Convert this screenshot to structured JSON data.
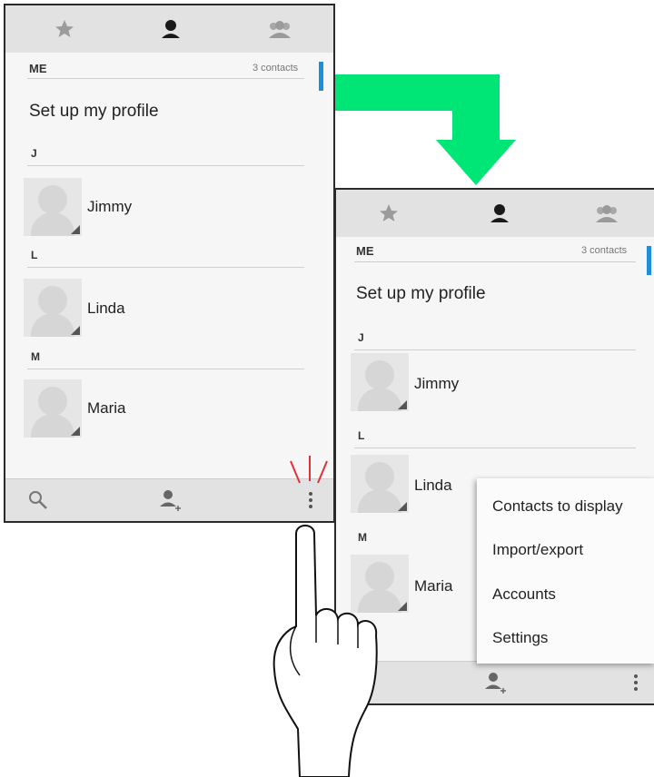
{
  "screen1": {
    "tabs": [
      {
        "icon": "star-icon"
      },
      {
        "icon": "person-icon"
      },
      {
        "icon": "group-icon"
      }
    ],
    "section_header": "ME",
    "contacts_count": "3 contacts",
    "profile_label": "Set up my profile",
    "groups": [
      {
        "letter": "J",
        "name": "Jimmy"
      },
      {
        "letter": "L",
        "name": "Linda"
      },
      {
        "letter": "M",
        "name": "Maria"
      }
    ],
    "bottom_bar": [
      {
        "icon": "search-icon"
      },
      {
        "icon": "add-contact-icon"
      },
      {
        "icon": "overflow-menu-icon"
      }
    ]
  },
  "screen2": {
    "section_header": "ME",
    "contacts_count": "3 contacts",
    "profile_label": "Set up my profile",
    "groups": [
      {
        "letter": "J",
        "name": "Jimmy"
      },
      {
        "letter": "L",
        "name": "Linda"
      },
      {
        "letter": "M",
        "name": "Maria"
      }
    ],
    "menu": {
      "items": [
        "Contacts to display",
        "Import/export",
        "Accounts",
        "Settings"
      ]
    }
  },
  "colors": {
    "arrow": "#00e676",
    "scroll_indicator": "#1e8fd6",
    "tap_lines": "#e0303a"
  }
}
